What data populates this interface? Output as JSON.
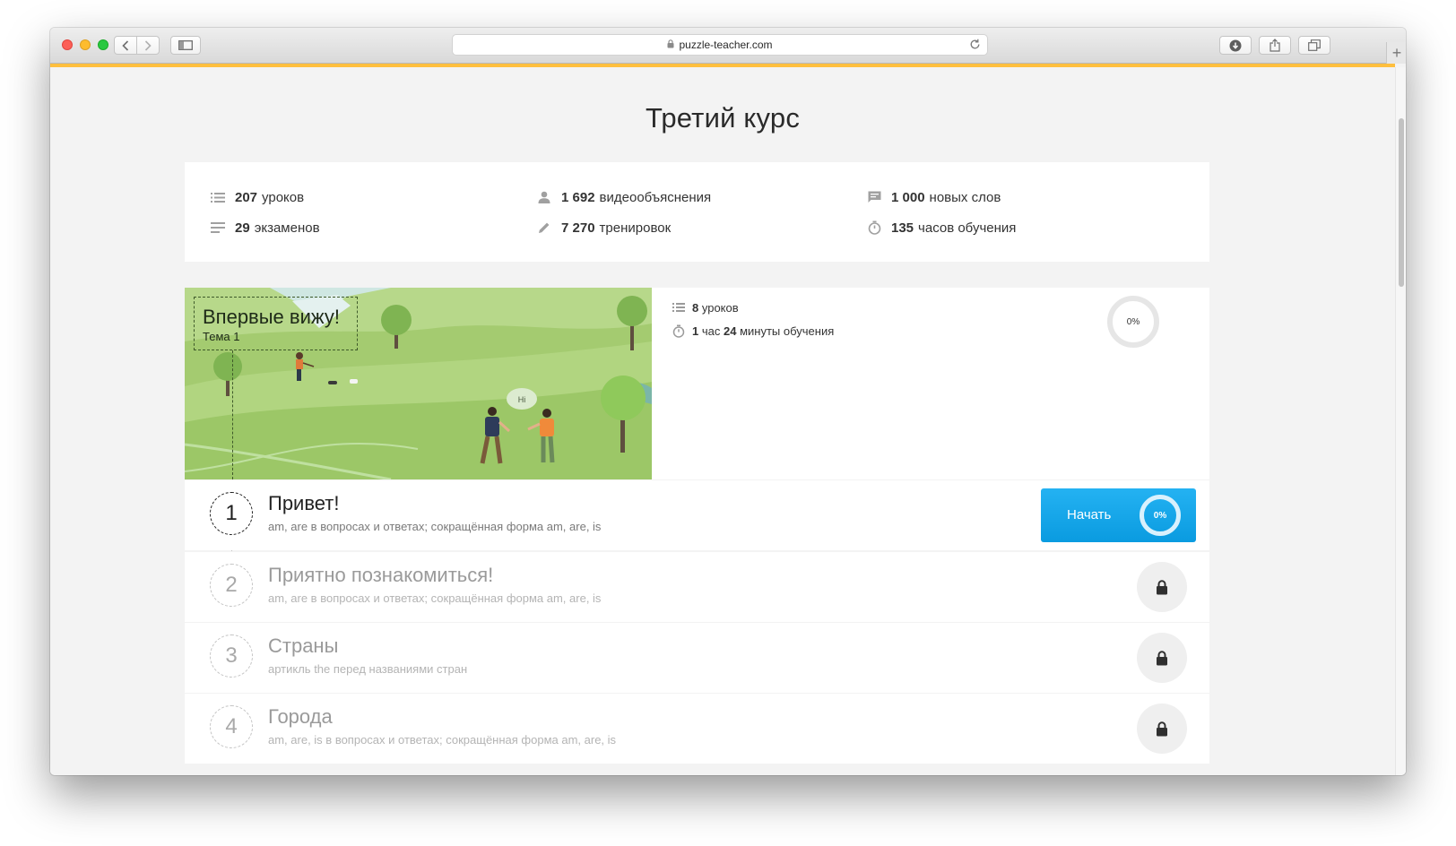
{
  "browser": {
    "url": "puzzle-teacher.com",
    "new_tab_label": "+"
  },
  "page": {
    "title": "Третий курс"
  },
  "stats": [
    {
      "icon": "list-icon",
      "value": "207",
      "label": "уроков"
    },
    {
      "icon": "person-icon",
      "value": "1 692",
      "label": "видеообъяснения"
    },
    {
      "icon": "chat-icon",
      "value": "1 000",
      "label": "новых слов"
    },
    {
      "icon": "lines-icon",
      "value": "29",
      "label": "экзаменов"
    },
    {
      "icon": "pencil-icon",
      "value": "7 270",
      "label": "тренировок"
    },
    {
      "icon": "stopwatch-icon",
      "value": "135",
      "label": "часов обучения"
    }
  ],
  "topic": {
    "name": "Впервые вижу!",
    "subtitle": "Тема 1",
    "bubble_text": "Hi",
    "lessons_count": "8",
    "lessons_label": "уроков",
    "duration_hours": "1",
    "duration_hours_label": "час",
    "duration_minutes": "24",
    "duration_minutes_label": "минуты обучения",
    "progress_label": "0%",
    "progress": 0
  },
  "lessons": [
    {
      "number": "1",
      "title": "Привет!",
      "description": "am, are в вопросах и ответах; сокращённая форма am, are, is",
      "locked": false,
      "button_label": "Начать",
      "progress_label": "0%",
      "progress": 0
    },
    {
      "number": "2",
      "title": "Приятно познакомиться!",
      "description": "am, are в вопросах и ответах; сокращённая форма am, are, is",
      "locked": true
    },
    {
      "number": "3",
      "title": "Страны",
      "description": "артикль the перед названиями стран",
      "locked": true
    },
    {
      "number": "4",
      "title": "Города",
      "description": "am, are, is в вопросах и ответах; сокращённая форма am, are, is",
      "locked": true
    }
  ],
  "colors": {
    "accent_orange": "#ffbf3e",
    "button_blue": "#0a9be0",
    "page_background": "#f3f3f3"
  }
}
